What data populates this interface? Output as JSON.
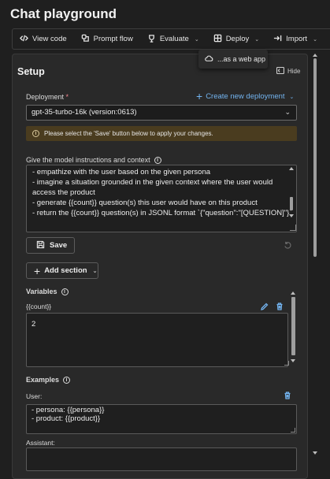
{
  "page": {
    "title": "Chat playground"
  },
  "toolbar": {
    "items": [
      {
        "label": "View code",
        "icon": "code-icon",
        "dropdown": false
      },
      {
        "label": "Prompt flow",
        "icon": "prompt-flow-icon",
        "dropdown": false
      },
      {
        "label": "Evaluate",
        "icon": "evaluate-icon",
        "dropdown": true
      },
      {
        "label": "Deploy",
        "icon": "deploy-icon",
        "dropdown": true
      },
      {
        "label": "Import",
        "icon": "import-icon",
        "dropdown": true
      }
    ]
  },
  "deploy_menu": {
    "option": "...as a web app",
    "icon": "cloud-icon"
  },
  "setup": {
    "title": "Setup",
    "hide_label": "Hide",
    "deployment": {
      "label": "Deployment",
      "required_mark": "*",
      "create_label": "Create new deployment",
      "selected": "gpt-35-turbo-16k (version:0613)"
    },
    "warning": "Please select the 'Save' button below to apply your changes.",
    "instructions": {
      "label": "Give the model instructions and context",
      "lines": [
        "- empathize with the user based on the given persona",
        "- imagine a situation grounded in the given context where the user would",
        "access the product",
        "- generate {{count}} question(s) this user would have on this product",
        "- return the {{count}} question(s) in JSONL format `{\"question\":\"[QUESTION]\"}`"
      ]
    },
    "save_label": "Save",
    "add_section_label": "Add section",
    "variables": {
      "label": "Variables",
      "name": "{{count}}",
      "value": "2"
    },
    "examples": {
      "label": "Examples",
      "user_label": "User:",
      "user_lines": [
        "- persona: {{persona}}",
        "- product: {{product}}"
      ],
      "assistant_label": "Assistant:"
    }
  },
  "colors": {
    "background": "#1f1f1f",
    "panel": "#292929",
    "accent": "#73b4f0",
    "warning_bg": "#4a3c1f",
    "required": "#f0838f"
  }
}
